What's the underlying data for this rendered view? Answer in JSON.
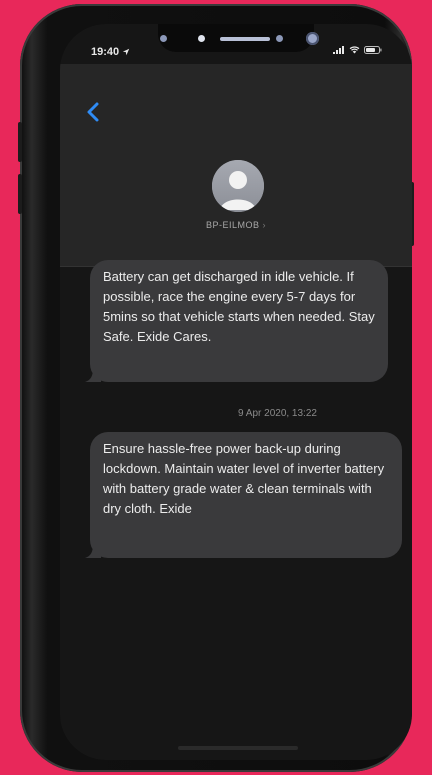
{
  "status_bar": {
    "time": "19:40"
  },
  "contact": {
    "sender_name": "BP-EILMOB",
    "chevron": "›"
  },
  "messages": [
    {
      "text": "Battery can get discharged in idle vehicle. If possible, race the engine every 5-7 days for 5mins so that vehicle starts when needed. Stay Safe. Exide Cares."
    },
    {
      "text": "Ensure hassle-free power back-up during lockdown. Maintain water level of inverter battery with battery grade water & clean terminals with dry cloth. Exide"
    }
  ],
  "timestamp": "9 Apr 2020, 13:22",
  "icons": {
    "back": "chevron-left-icon",
    "avatar": "person-icon",
    "signal": "signal-icon",
    "wifi": "wifi-icon",
    "battery": "battery-icon",
    "location": "location-arrow-icon"
  },
  "colors": {
    "background": "#e8285a",
    "accent": "#2f8cf5",
    "bubble": "#3a3a3c"
  }
}
